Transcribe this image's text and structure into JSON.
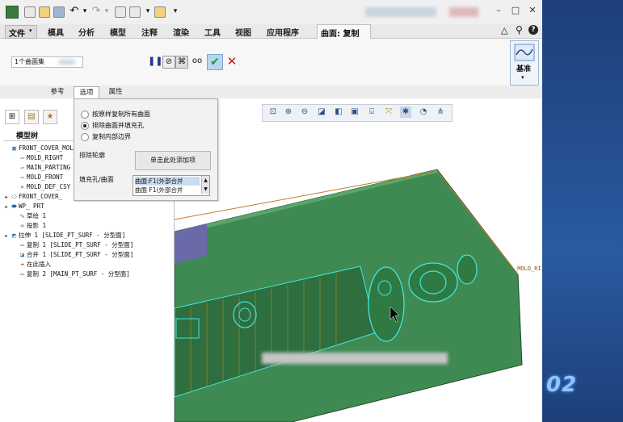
{
  "menubar": {
    "file": "文件",
    "items": [
      "模具",
      "分析",
      "模型",
      "注释",
      "渲染",
      "工具",
      "视图",
      "应用程序"
    ],
    "active_tab": "曲面: 复制"
  },
  "dashboard": {
    "collector": "1个曲面集",
    "base_button": "基准"
  },
  "tabs": [
    "参考",
    "选项",
    "属性"
  ],
  "options": {
    "radios": [
      {
        "label": "按原样复制所有曲面",
        "checked": false
      },
      {
        "label": "排除曲面并填充孔",
        "checked": true
      },
      {
        "label": "复制内部边界",
        "checked": false
      }
    ],
    "exclude_label": "排除轮廓",
    "add_button": "单击此处添加项",
    "fill_label": "填充孔/曲面",
    "fill_items": [
      "曲面:F1(外部合并",
      "曲面 F1(外部合并"
    ]
  },
  "model_tree": {
    "title": "模型树",
    "items": [
      {
        "text": "FRONT_COVER_MOL",
        "icon": "assembly-icon",
        "arrow": false,
        "indent": 0
      },
      {
        "text": "MOLD_RIGHT",
        "icon": "datum-plane-icon",
        "arrow": false,
        "indent": 1
      },
      {
        "text": "MAIN_PARTING",
        "icon": "datum-plane-icon",
        "arrow": false,
        "indent": 1
      },
      {
        "text": "MOLD_FRONT",
        "icon": "datum-plane-icon",
        "arrow": false,
        "indent": 1
      },
      {
        "text": "MOLD_DEF_CSY",
        "icon": "csys-icon",
        "arrow": false,
        "indent": 1
      },
      {
        "text": "FRONT_COVER_",
        "icon": "part-icon",
        "arrow": true,
        "indent": 0
      },
      {
        "text": "WP_ PRT",
        "icon": "workpiece-icon",
        "arrow": true,
        "indent": 0
      },
      {
        "text": "草绘 1",
        "icon": "sketch-icon",
        "arrow": false,
        "indent": 1
      },
      {
        "text": "投影 1",
        "icon": "projection-icon",
        "arrow": false,
        "indent": 1
      },
      {
        "text": "拉伸 1 [SLIDE_PT_SURF - 分型面]",
        "icon": "extrude-icon",
        "arrow": true,
        "indent": 0
      },
      {
        "text": "复制 1 [SLIDE_PT_SURF - 分型面]",
        "icon": "copy-icon",
        "arrow": false,
        "indent": 1
      },
      {
        "text": "合并 1 [SLIDE_PT_SURF - 分型面]",
        "icon": "merge-icon",
        "arrow": false,
        "indent": 1
      },
      {
        "text": "在此插入",
        "icon": "insert-here-icon",
        "arrow": false,
        "indent": 1
      },
      {
        "text": "复制 2 [MAIN_PT_SURF - 分型面]",
        "icon": "copy-icon",
        "arrow": false,
        "indent": 1
      }
    ]
  },
  "graphics": {
    "label": "_MOLD_RI"
  },
  "desktop": {
    "digits": "02"
  }
}
